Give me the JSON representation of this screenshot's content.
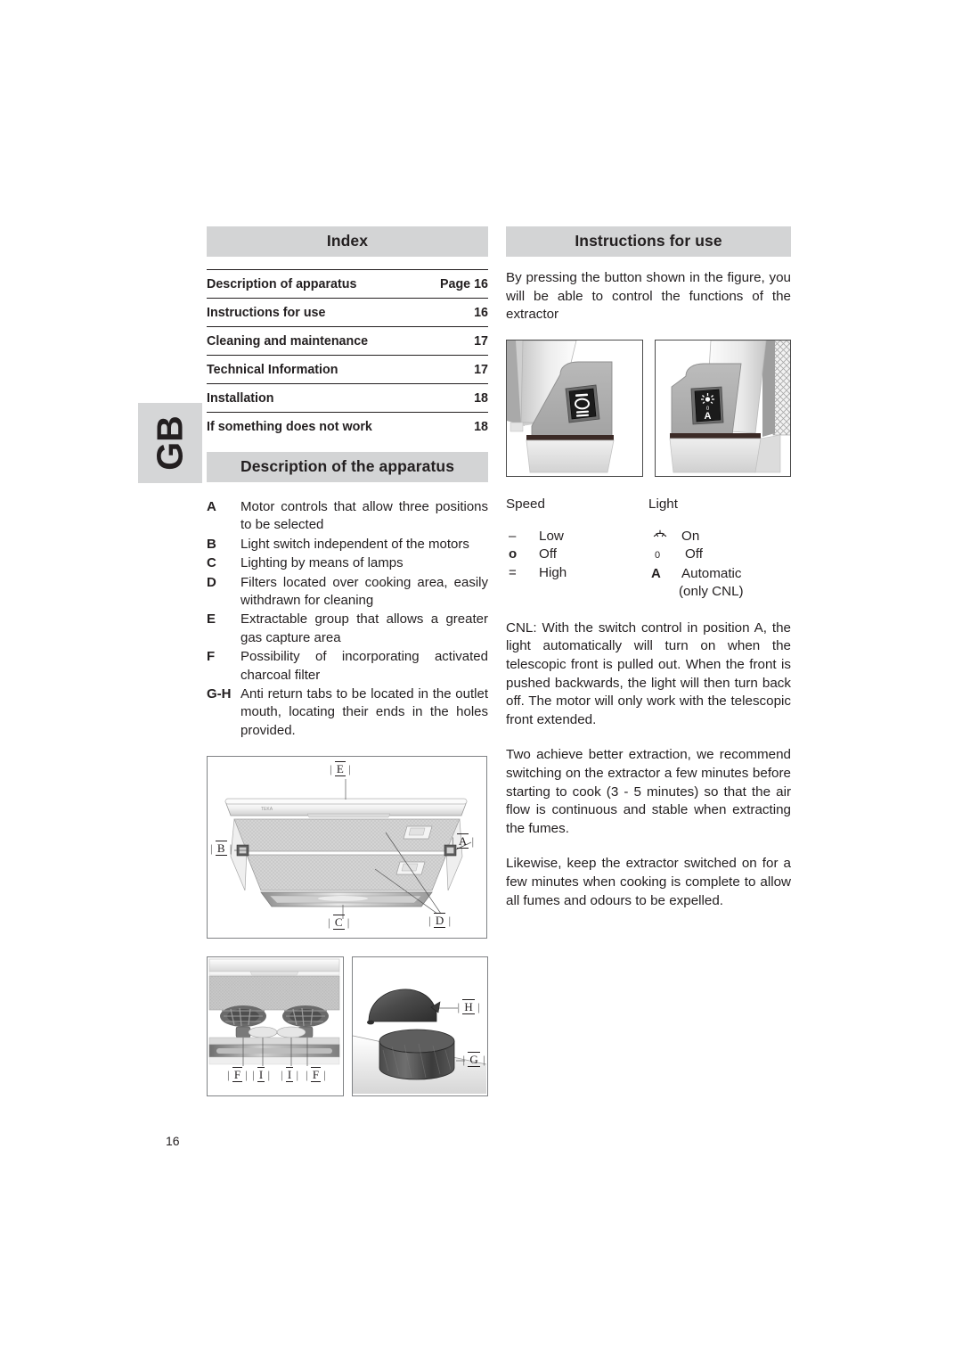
{
  "language_tab": "GB",
  "page_number": "16",
  "index": {
    "heading": "Index",
    "rows": [
      {
        "title": "Description of apparatus",
        "page": "Page 16"
      },
      {
        "title": "Instructions for use",
        "page": "16"
      },
      {
        "title": "Cleaning and maintenance",
        "page": "17"
      },
      {
        "title": "Technical Information",
        "page": "17"
      },
      {
        "title": "Installation",
        "page": "18"
      },
      {
        "title": "If something does not work",
        "page": "18"
      }
    ]
  },
  "description": {
    "heading": "Description of the apparatus",
    "items": [
      {
        "key": "A",
        "text": "Motor controls that allow three positions to be selected"
      },
      {
        "key": "B",
        "text": "Light switch independent of the motors"
      },
      {
        "key": "C",
        "text": "Lighting by means of lamps"
      },
      {
        "key": "D",
        "text": "Filters located over cooking area, easily withdrawn for cleaning"
      },
      {
        "key": "E",
        "text": "Extractable group that allows a greater gas capture area"
      },
      {
        "key": "F",
        "text": "Possibility of incorporating activated charcoal filter"
      },
      {
        "key": "G-H",
        "text": "Anti return tabs to be located in the outlet mouth, locating their ends in the holes provided."
      }
    ]
  },
  "instructions": {
    "heading": "Instructions for use",
    "intro": "By pressing the button shown in the figure, you will be able to control the functions of the extractor",
    "paragraph_cnl": "CNL: With the switch control in position A, the light automatically will turn on when the telescopic front is pulled out.  When the front is pushed backwards, the light will then turn back off.  The motor will only work with the telescopic front extended.",
    "paragraph_extraction": "Two achieve better extraction, we recommend switching on the extractor a few minutes before starting to cook (3 - 5 minutes) so that the air flow is continuous and stable when extracting the fumes.",
    "paragraph_likewise": "Likewise, keep the extractor switched on for a few minutes when cooking is complete to allow all fumes and odours to be expelled."
  },
  "legend": {
    "speed": {
      "heading": "Speed",
      "rows": [
        {
          "symbol": "–",
          "label": "Low"
        },
        {
          "symbol": "o",
          "label": "Off"
        },
        {
          "symbol": "=",
          "label": "High"
        }
      ]
    },
    "light": {
      "heading": "Light",
      "rows": [
        {
          "symbol": "light-on-icon",
          "label": "On"
        },
        {
          "symbol": "0",
          "label": "Off"
        },
        {
          "symbol": "A",
          "label": "Automatic"
        }
      ],
      "sub_note": "(only CNL)"
    }
  },
  "figures": {
    "photo_speed_switch": {
      "name": "speed-rocker-switch-photo",
      "switch_marks": [
        "–",
        "O",
        "="
      ]
    },
    "photo_light_switch": {
      "name": "light-switch-photo",
      "switch_marks": [
        "sun-icon",
        "0",
        "A"
      ]
    },
    "diagram_main": {
      "name": "hood-overview-diagram",
      "callouts": [
        "E",
        "B",
        "A",
        "C",
        "D"
      ]
    },
    "diagram_filters": {
      "name": "filter-detail-diagram",
      "callouts": [
        "F",
        "I",
        "I",
        "F"
      ]
    },
    "diagram_tabs": {
      "name": "anti-return-tabs-diagram",
      "callouts": [
        "H",
        "G"
      ]
    }
  },
  "colors": {
    "header_bar": "#d3d4d5",
    "tab_bg": "#d5d6d7",
    "text": "#231f20",
    "rule": "#231f20"
  }
}
